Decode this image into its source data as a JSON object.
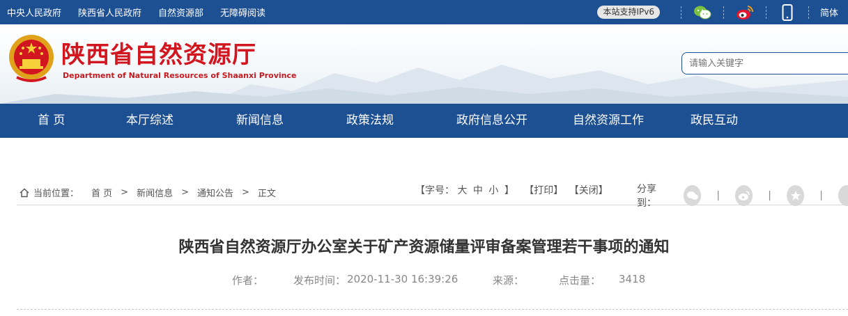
{
  "topbar": {
    "links": [
      "中央人民政府",
      "陕西省人民政府",
      "自然资源部",
      "无障碍阅读"
    ],
    "ipv6_badge": "本站支持IPv6",
    "icons": [
      "wechat-icon",
      "weibo-icon",
      "mobile-icon"
    ],
    "lang_toggle": "简体"
  },
  "header": {
    "title": "陕西省自然资源厅",
    "subtitle": "Department of Natural Resources of Shaanxi Province",
    "search_placeholder": "请输入关键字"
  },
  "nav": {
    "items": [
      "首  页",
      "本厅综述",
      "新闻信息",
      "政策法规",
      "政府信息公开",
      "自然资源工作",
      "政民互动"
    ]
  },
  "breadcrumb": {
    "label": "当前位置：",
    "items": [
      "首 页",
      "新闻信息",
      "通知公告",
      "正文"
    ],
    "separator": ">"
  },
  "tools": {
    "font_size_label": "【字号：",
    "size_large": "大",
    "size_medium": "中",
    "size_small": "小",
    "font_size_close": "】",
    "print": "【打印】",
    "close": "【关闭】"
  },
  "share": {
    "label": "分享到：",
    "divider": "|",
    "icons": [
      "wechat-share-icon",
      "weibo-share-icon",
      "favorite-share-icon",
      "more-share-icon"
    ]
  },
  "article": {
    "title": "陕西省自然资源厅办公室关于矿产资源储量评审备案管理若干事项的通知",
    "author_label": "作者：",
    "publish_time_label": "发布时间：",
    "publish_time": "2020-11-30 16:39:26",
    "source_label": "来源：",
    "views_label": "点击量：",
    "views": "3418"
  },
  "colors": {
    "brand_blue": "#1d4f93",
    "title_red": "#d2161f"
  }
}
